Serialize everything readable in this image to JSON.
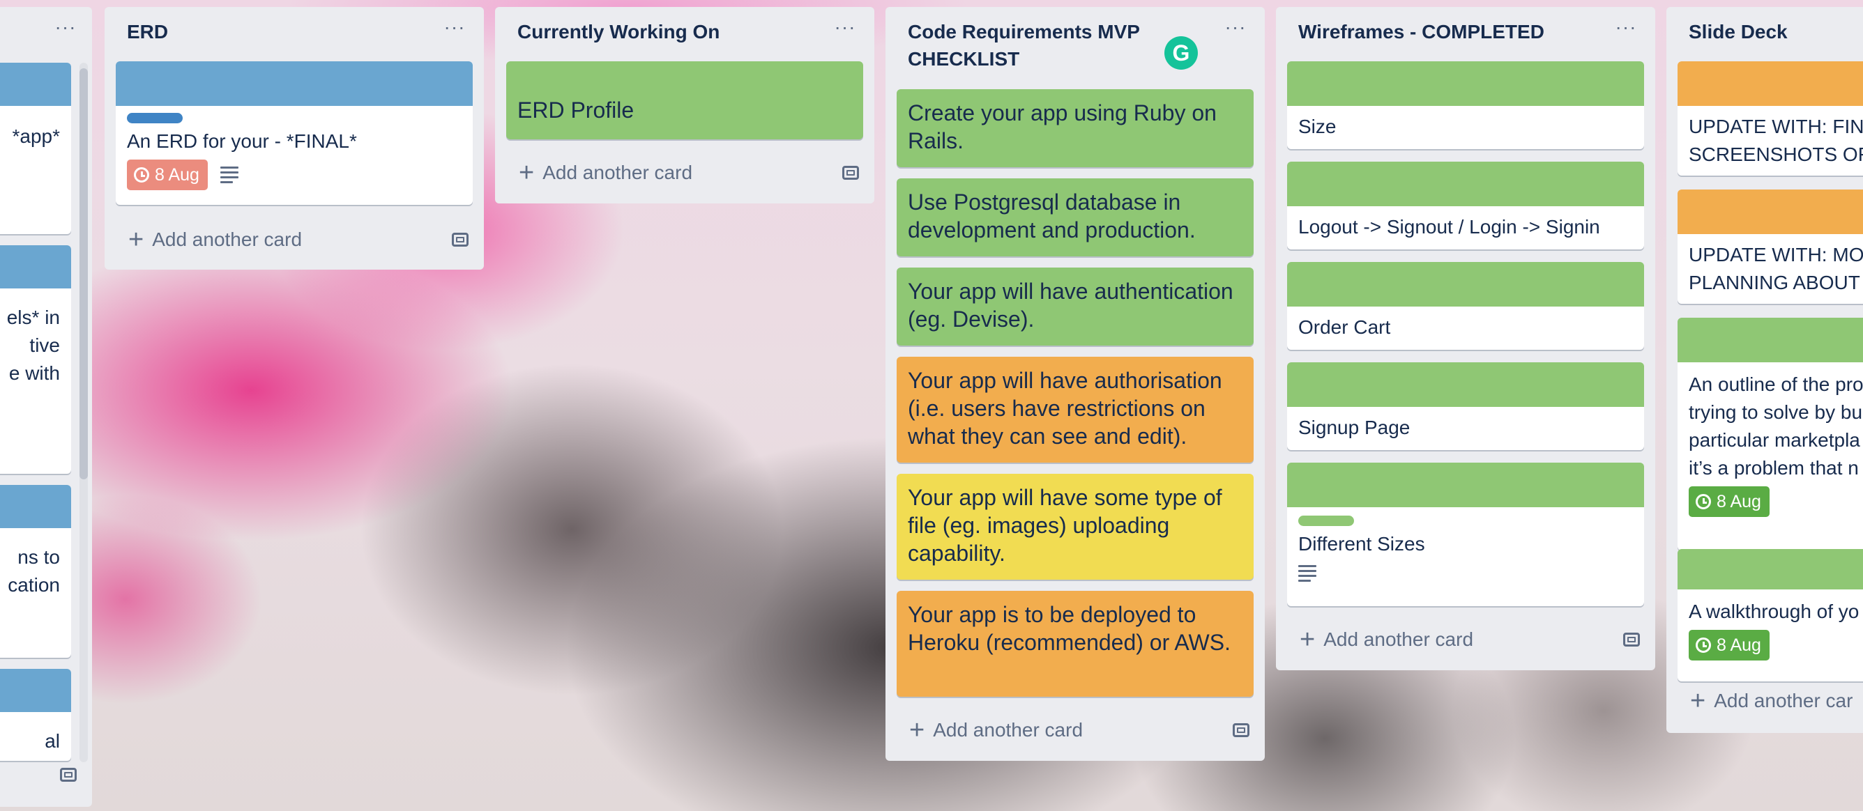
{
  "colors": {
    "list_bg": "#ebecf0",
    "green": "#8fc774",
    "orange": "#f2ad4e",
    "yellow": "#f1dc52",
    "blue": "#6aa6d0",
    "label_blue": "#3f84c5",
    "due_overdue": "#eb8c7e",
    "due_complete": "#5aac44"
  },
  "partial_list": {
    "cards": [
      {
        "text": "*app*"
      },
      {
        "lines": [
          "els* in",
          "tive",
          "e with"
        ]
      },
      {
        "lines": [
          "ns to",
          "cation"
        ]
      },
      {
        "text": "al"
      }
    ]
  },
  "erd": {
    "title": "ERD",
    "menu": "···",
    "card_title": "An ERD for your - *FINAL*",
    "due": "8 Aug",
    "add": "Add another card"
  },
  "working": {
    "title": "Currently Working On",
    "menu": "···",
    "card_title": "ERD Profile",
    "add": "Add another card"
  },
  "checklist": {
    "title": "Code Requirements MVP CHECKLIST",
    "menu": "···",
    "grammarly": "G",
    "cards": [
      "Create your app using Ruby on Rails.",
      "Use Postgresql database in development and production.",
      "Your app will have authentication (eg. Devise).",
      "Your app will have authorisation (i.e. users have restrictions on what they can see and edit).",
      "Your app will have some type of file (eg. images) uploading capability.",
      "Your app is to be deployed to Heroku (recommended) or AWS."
    ],
    "add": "Add another card"
  },
  "wireframes": {
    "title": "Wireframes - COMPLETED",
    "menu": "···",
    "cards": [
      "Size",
      "Logout -> Signout / Login -> Signin",
      "Order Cart",
      "Signup Page",
      "Different Sizes"
    ],
    "add": "Add another card"
  },
  "slides": {
    "title": "Slide Deck",
    "card1_lines": [
      "UPDATE WITH: FINA",
      "SCREENSHOTS OF"
    ],
    "card2_lines": [
      "UPDATE WITH: MO",
      "PLANNING ABOUT"
    ],
    "card3_lines": [
      "An outline of the pro",
      "trying to solve by bu",
      "particular marketpla",
      "it’s a problem that n"
    ],
    "card3_due": "8 Aug",
    "card4_text": "A walkthrough of yo",
    "card4_due": "8 Aug",
    "add": "Add another car"
  }
}
